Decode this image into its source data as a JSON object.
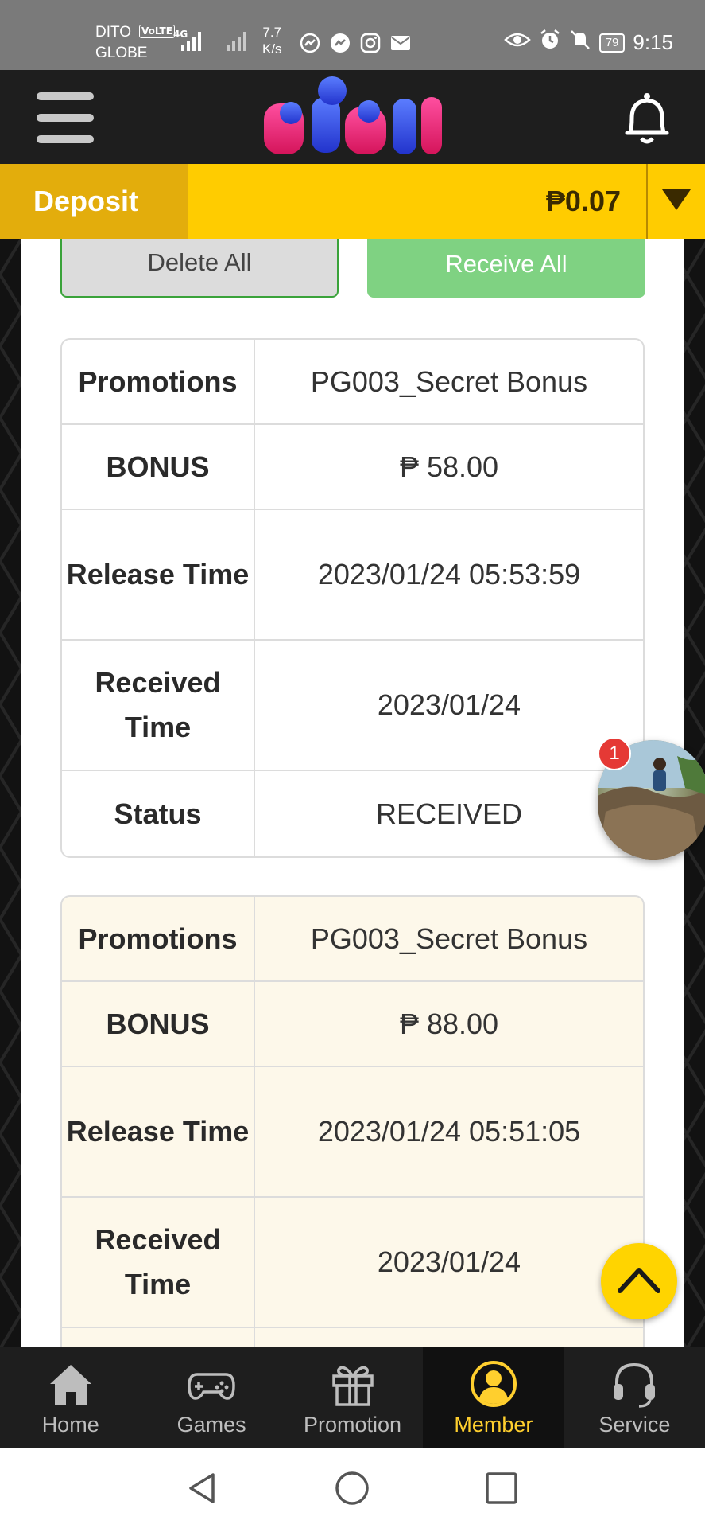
{
  "status_bar": {
    "carrier_1": "DITO",
    "carrier_2": "GLOBE",
    "volte": "VoLTE",
    "network": "4G",
    "speed_value": "7.7",
    "speed_unit": "K/s",
    "battery": "79",
    "time": "9:15"
  },
  "header": {
    "logo_text": "PGBI"
  },
  "deposit_bar": {
    "deposit_label": "Deposit",
    "balance": "₱0.07"
  },
  "actions": {
    "delete_all": "Delete All",
    "receive_all": "Receive All"
  },
  "records": [
    {
      "promotions_label": "Promotions",
      "promotions": "PG003_Secret Bonus",
      "bonus_label": "BONUS",
      "bonus": "₱ 58.00",
      "release_label": "Release Time",
      "release_time": "2023/01/24 05:53:59",
      "received_label": "Received Time",
      "received_time": "2023/01/24",
      "status_label": "Status",
      "status": "RECEIVED"
    },
    {
      "promotions_label": "Promotions",
      "promotions": "PG003_Secret Bonus",
      "bonus_label": "BONUS",
      "bonus": "₱ 88.00",
      "release_label": "Release Time",
      "release_time": "2023/01/24 05:51:05",
      "received_label": "Received Time",
      "received_time": "2023/01/24"
    }
  ],
  "floating": {
    "badge_count": "1"
  },
  "bottom_nav": [
    {
      "label": "Home",
      "icon": "home-icon"
    },
    {
      "label": "Games",
      "icon": "gamepad-icon"
    },
    {
      "label": "Promotion",
      "icon": "gift-icon"
    },
    {
      "label": "Member",
      "icon": "member-icon",
      "active": true
    },
    {
      "label": "Service",
      "icon": "headset-icon"
    }
  ],
  "colors": {
    "accent_yellow": "#ffcc00",
    "deposit_button": "#e3ad0c",
    "receive_green": "#7fd282",
    "active_nav": "#ffcf2e",
    "card2_background": "#fdf8ea"
  }
}
